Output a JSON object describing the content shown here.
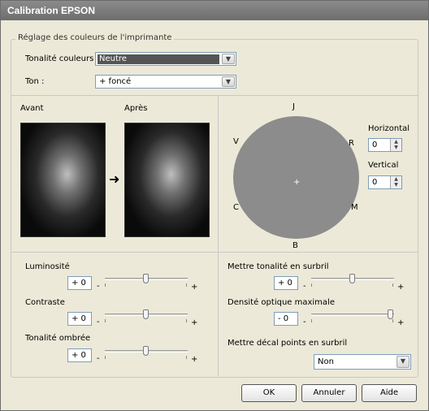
{
  "window": {
    "title": "Calibration EPSON"
  },
  "group": {
    "legend": "Réglage des couleurs de l'imprimante"
  },
  "tonalite": {
    "label": "Tonalité couleurs :",
    "value": "Neutre"
  },
  "ton": {
    "label": "Ton :",
    "value": "+ foncé"
  },
  "preview": {
    "before": "Avant",
    "after": "Après",
    "arrow": "➜"
  },
  "color_wheel": {
    "labels": {
      "top": "J",
      "right_top": "R",
      "right_bottom": "M",
      "bottom": "B",
      "left_bottom": "C",
      "left_top": "V"
    },
    "center": "+",
    "color": "#8c8c8c"
  },
  "horizontal": {
    "label": "Horizontal",
    "value": "0"
  },
  "vertical": {
    "label": "Vertical",
    "value": "0"
  },
  "luminosite": {
    "label": "Luminosité",
    "value": "+ 0",
    "level": 0.5
  },
  "contraste": {
    "label": "Contraste",
    "value": "+ 0",
    "level": 0.5
  },
  "tonalite_ombree": {
    "label": "Tonalité ombrée",
    "value": "+ 0",
    "level": 0.5
  },
  "mettre_tonalite": {
    "label": "Mettre tonalité en surbril",
    "value": "+ 0",
    "level": 0.5
  },
  "densite": {
    "label": "Densité optique maximale",
    "value": "- 0",
    "level": 1.0
  },
  "decal": {
    "label": "Mettre décal points en surbril",
    "value": "Non"
  },
  "slider_signs": {
    "minus": "-",
    "plus": "+"
  },
  "buttons": {
    "ok": "OK",
    "cancel": "Annuler",
    "help": "Aide"
  }
}
